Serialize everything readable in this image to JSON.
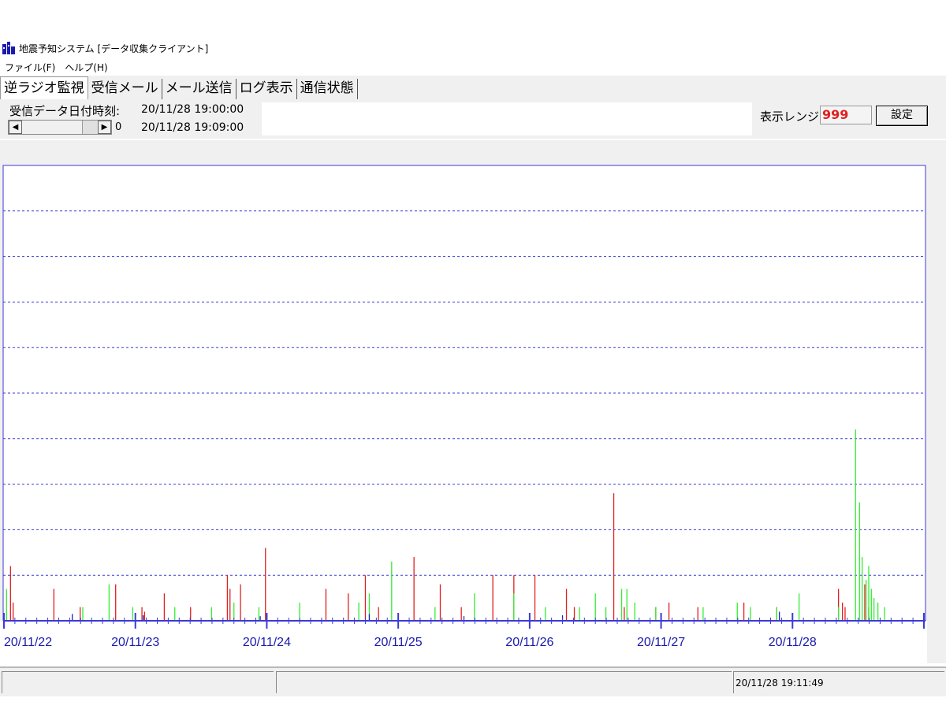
{
  "window": {
    "title": "地震予知システム [データ収集クライアント]",
    "icon": "app-icon"
  },
  "menu": [
    "ファイル(F)",
    "ヘルプ(H)"
  ],
  "tabs": [
    "逆ラジオ監視",
    "受信メール",
    "メール送信",
    "ログ表示",
    "通信状態"
  ],
  "active_tab": 0,
  "controls": {
    "recv_label": "受信データ日付時刻:",
    "time_start": "20/11/28 19:00:00",
    "time_end": "20/11/28 19:09:00",
    "scroll_value": "0",
    "range_label": "表示レンジ:",
    "range_value": "999",
    "set_button": "設定"
  },
  "status": {
    "pane1": "",
    "pane2": "",
    "datetime": "20/11/28 19:11:49"
  },
  "colors": {
    "frame": "#3a3ad6",
    "red": "#e02020",
    "green": "#33ee33",
    "blue": "#2020c0",
    "label": "#1a1ab0"
  },
  "chart_data": {
    "type": "bar",
    "xlabel": "",
    "ylabel": "",
    "x_ticks": [
      "20/11/22",
      "20/11/23",
      "20/11/24",
      "20/11/25",
      "20/11/26",
      "20/11/27",
      "20/11/28"
    ],
    "x_range_days": [
      0,
      7
    ],
    "ylim": [
      0,
      10
    ],
    "grid": true,
    "series": [
      {
        "color": "red",
        "x": [
          0.05,
          0.07,
          0.38,
          0.58,
          0.85,
          1.05,
          1.07,
          1.22,
          1.42,
          1.7,
          1.72,
          1.8,
          1.99,
          2.45,
          2.62,
          2.75,
          2.85,
          3.12,
          3.32,
          3.48,
          3.72,
          3.88,
          4.04,
          4.28,
          4.34,
          4.64,
          4.72,
          4.96,
          5.06,
          5.28,
          5.63,
          5.88,
          6.35,
          6.38,
          6.4,
          6.55,
          6.58
        ],
        "y": [
          1.2,
          0.4,
          0.7,
          0.3,
          0.8,
          0.3,
          0.2,
          0.6,
          0.3,
          1.0,
          0.7,
          0.8,
          1.6,
          0.7,
          0.6,
          1.0,
          0.3,
          1.4,
          0.8,
          0.3,
          1.0,
          1.0,
          1.0,
          0.7,
          0.3,
          2.8,
          0.3,
          0.3,
          0.4,
          0.3,
          0.4,
          0.3,
          0.7,
          0.4,
          0.3,
          0.8,
          0.3
        ]
      },
      {
        "color": "green",
        "x": [
          0.02,
          0.6,
          0.8,
          0.98,
          1.3,
          1.58,
          1.75,
          1.94,
          2.25,
          2.7,
          2.78,
          2.95,
          3.28,
          3.58,
          3.88,
          4.12,
          4.38,
          4.5,
          4.58,
          4.7,
          4.74,
          4.8,
          4.96,
          5.32,
          5.58,
          5.68,
          5.88,
          6.05,
          6.35,
          6.48,
          6.51,
          6.53,
          6.56,
          6.58,
          6.6,
          6.62,
          6.65,
          6.7
        ],
        "y": [
          0.7,
          0.3,
          0.8,
          0.3,
          0.3,
          0.3,
          0.4,
          0.3,
          0.4,
          0.4,
          0.6,
          1.3,
          0.3,
          0.6,
          0.6,
          0.3,
          0.3,
          0.6,
          0.3,
          0.7,
          0.7,
          0.4,
          0.3,
          0.3,
          0.4,
          0.3,
          0.3,
          0.6,
          0.3,
          4.2,
          2.6,
          1.4,
          0.9,
          1.2,
          0.7,
          0.5,
          0.4,
          0.3
        ]
      },
      {
        "color": "blue",
        "x": [
          0.52,
          1.06,
          1.95,
          2.78,
          3.5,
          4.25,
          5.9
        ],
        "y": [
          0.15,
          0.12,
          0.1,
          0.15,
          0.1,
          0.12,
          0.2
        ]
      }
    ]
  }
}
